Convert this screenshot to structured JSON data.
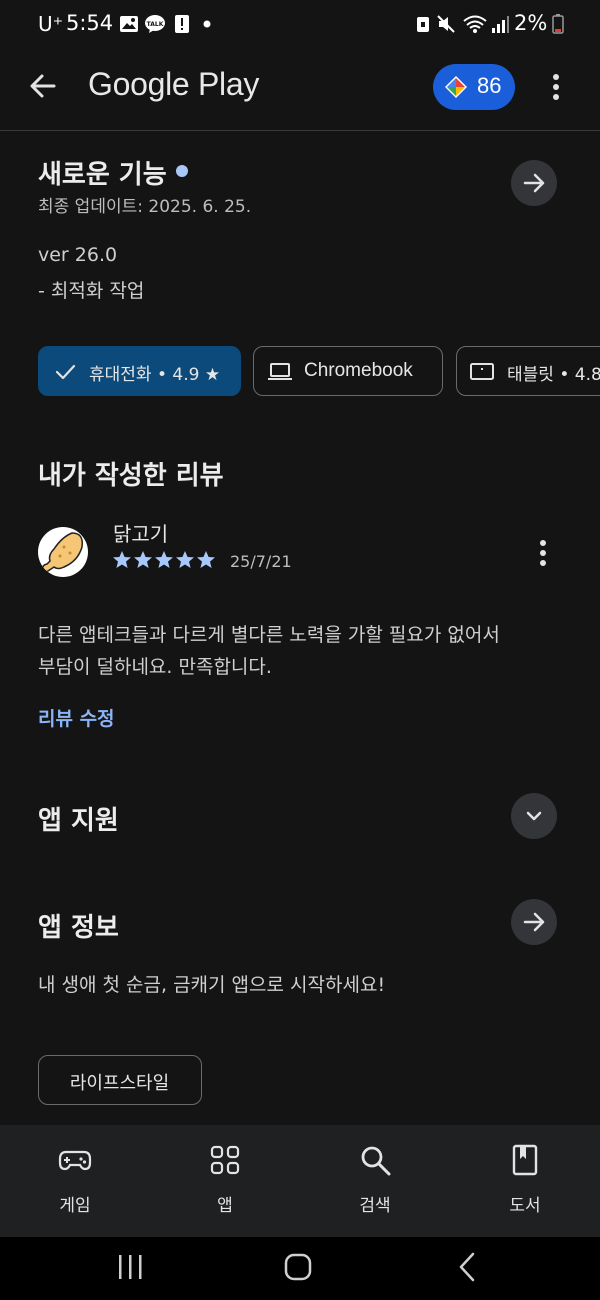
{
  "status_bar": {
    "carrier": "U⁺",
    "time": "5:54",
    "battery": "2%",
    "notification_icons": [
      "image-icon",
      "kakaotalk-icon",
      "alert-icon",
      "dot-icon"
    ],
    "system_icons": [
      "lock-icon",
      "mute-icon",
      "wifi-icon",
      "signal-icon",
      "battery-icon"
    ]
  },
  "app_bar": {
    "title": "Google Play",
    "points": "86"
  },
  "whats_new": {
    "title": "새로운 기능",
    "updated": "최종 업데이트: 2025. 6. 25.",
    "version": "ver 26.0",
    "note": "- 최적화 작업"
  },
  "device_chips": [
    {
      "label": "휴대전화 • 4.9 ★",
      "selected": true
    },
    {
      "label": "Chromebook",
      "selected": false
    },
    {
      "label": "태블릿 • 4.8",
      "selected": false
    }
  ],
  "my_review": {
    "section_title": "내가 작성한 리뷰",
    "author": "닭고기",
    "rating": 5,
    "date": "25/7/21",
    "text_line1": "다른 앱테크들과 다르게 별다른 노력을 가할 필요가 없어서",
    "text_line2": "부담이 덜하네요. 만족합니다.",
    "edit_label": "리뷰 수정"
  },
  "app_support": {
    "title": "앱 지원"
  },
  "app_info": {
    "title": "앱 정보",
    "description": "내 생애 첫 순금, 금캐기 앱으로 시작하세요!",
    "category": "라이프스타일"
  },
  "bottom_nav": [
    {
      "label": "게임",
      "icon": "gamepad-icon"
    },
    {
      "label": "앱",
      "icon": "apps-grid-icon"
    },
    {
      "label": "검색",
      "icon": "search-icon"
    },
    {
      "label": "도서",
      "icon": "book-icon"
    }
  ],
  "colors": {
    "background": "#141414",
    "accent_blue": "#1a5fd9",
    "selected_chip": "#0b4a7a",
    "link": "#8ab4f8",
    "star": "#a8c7fa"
  }
}
